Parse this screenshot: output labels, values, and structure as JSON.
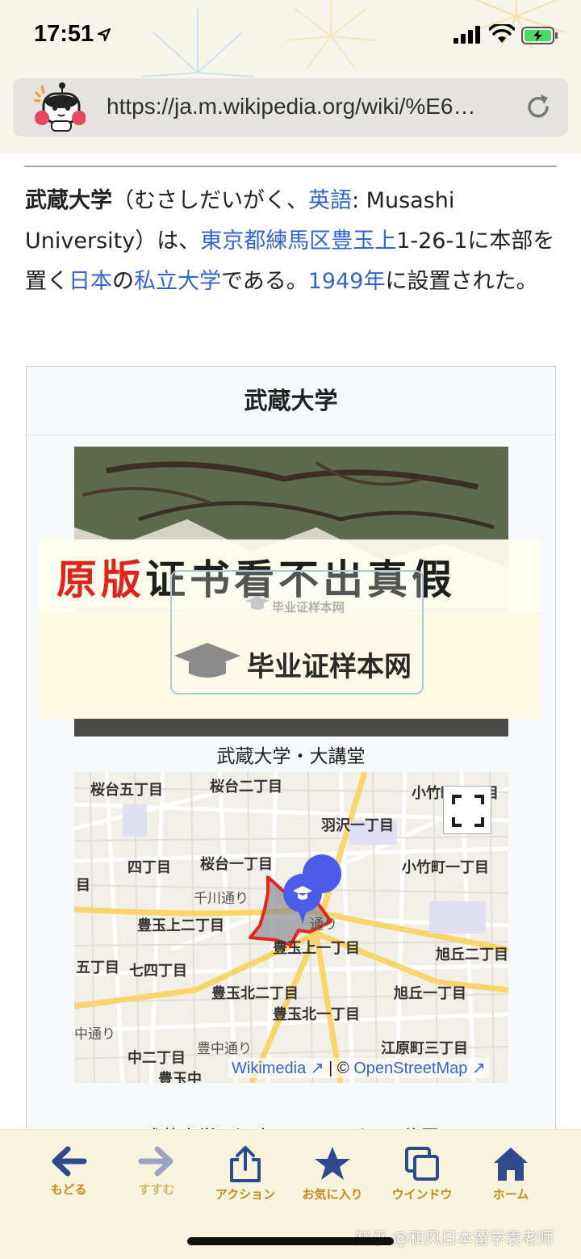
{
  "status_bar": {
    "time": "17:51"
  },
  "browser": {
    "url": "https://ja.m.wikipedia.org/wiki/%E6…"
  },
  "article": {
    "intro": {
      "t1": "武蔵大学",
      "t2": "（むさしだいがく、",
      "l_english": "英語",
      "t3": ": Musashi University）は、",
      "l_location": "東京都練馬区豊玉上",
      "t4": "1-26-1に本部を置く",
      "l_japan": "日本",
      "t5": "の",
      "l_private": "私立大学",
      "t6": "である。",
      "l_year": "1949年",
      "t7": "に設置された。"
    },
    "infobox": {
      "title": "武蔵大学",
      "photo_caption": "武蔵大学・大講堂",
      "map_attribution_wikimedia": "Wikimedia",
      "map_attribution_sep": "| ©",
      "map_attribution_osm": "OpenStreetMap",
      "map_caption": "武蔵大学・江古田キャンパスの位置",
      "map_labels": {
        "l1": "桜台五丁目",
        "l2": "桜台二丁目",
        "l3": "小竹町二丁目",
        "l4": "羽沢一丁目",
        "l5": "小竹町一丁目",
        "l6": "四丁目",
        "l7": "桜台一丁目",
        "l8": "千川通り",
        "l9": "豊玉上二丁目",
        "l10": "豊玉上一丁目",
        "l11": "旭丘二丁目",
        "l12": "五丁目",
        "l13": "七四丁目",
        "l14": "豊玉北二丁目",
        "l15": "旭丘一丁目",
        "l16": "豊玉北一丁目",
        "l17": "中通り",
        "l18": "豊中通り",
        "l19": "江原町三丁目",
        "l20": "中二丁目",
        "l21": "豊玉中",
        "l22": "目",
        "l23": "通り"
      }
    }
  },
  "watermark": {
    "headline_red": "原版",
    "headline_black": "证书看不出真假",
    "small": "毕业证样本网",
    "big": "毕业证样本网"
  },
  "toolbar": {
    "back": "もどる",
    "forward": "すすむ",
    "action": "アクション",
    "favorites": "お気に入り",
    "window": "ウインドウ",
    "home": "ホーム"
  },
  "footer_mark": "知乎 @和风日本留学袁老师",
  "colors": {
    "link": "#3366cc",
    "toolbar_accent": "#c98a1d",
    "map_outline": "#e8251b",
    "pin": "#4c5be8"
  }
}
